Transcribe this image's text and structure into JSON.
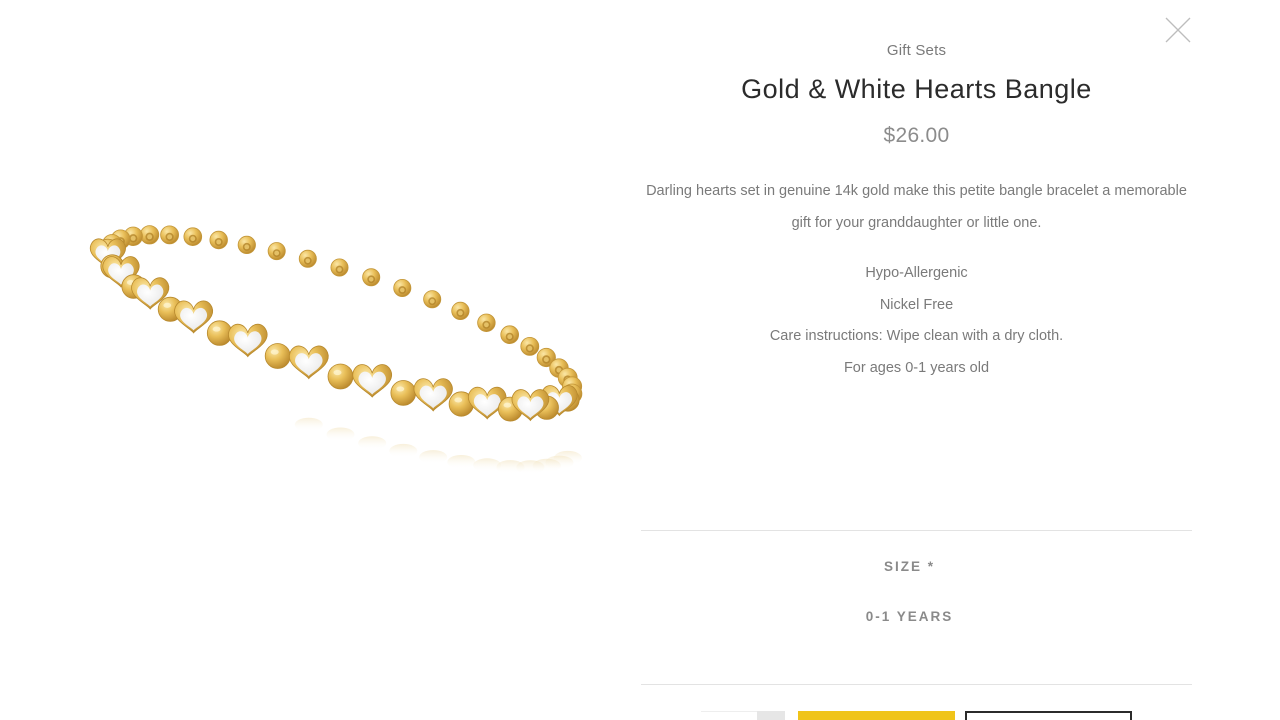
{
  "product": {
    "category": "Gift Sets",
    "title": "Gold & White Hearts Bangle",
    "price": "$26.00",
    "description": "Darling hearts set in genuine 14k gold make this petite bangle bracelet a memorable gift for your granddaughter or little one.",
    "features": [
      "Hypo-Allergenic",
      "Nickel Free",
      "Care instructions: Wipe clean with a dry cloth.",
      "For ages 0-1 years old"
    ]
  },
  "size": {
    "label": "SIZE *",
    "selected": "0-1 YEARS"
  },
  "icons": {
    "close": "close-icon"
  },
  "colors": {
    "gold": "#e2b34a",
    "accent_yellow": "#f0c419",
    "text_dark": "#2b2b2b",
    "text_muted": "#7a7a7a"
  }
}
